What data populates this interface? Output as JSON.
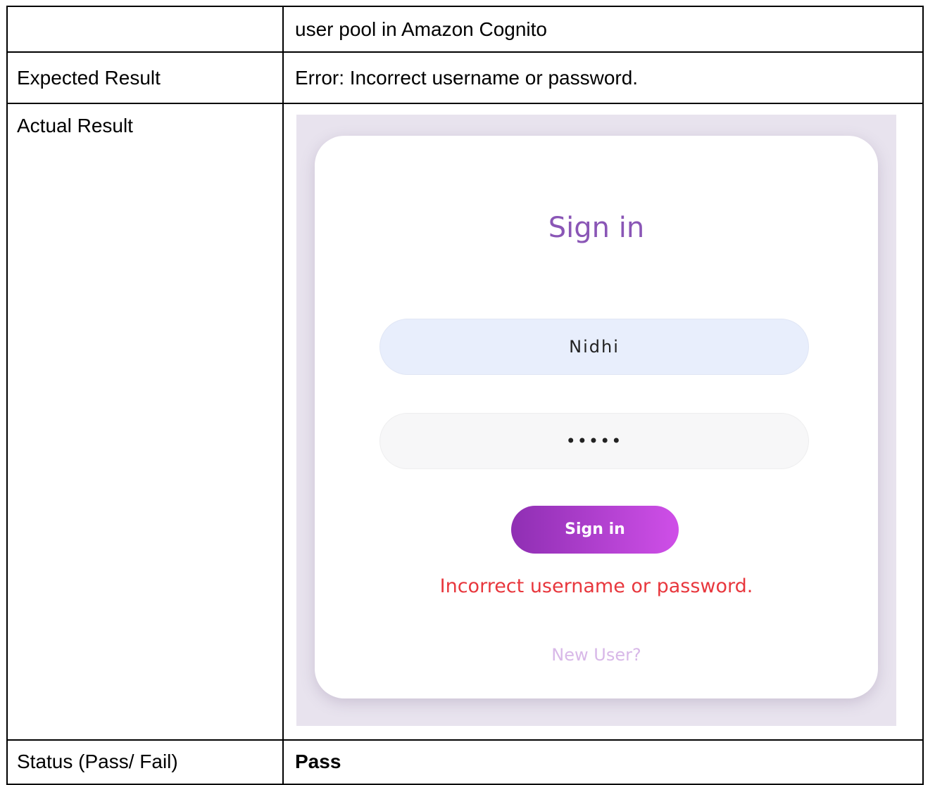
{
  "table": {
    "rows": [
      {
        "label": "",
        "value": "user pool in Amazon Cognito"
      },
      {
        "label": "Expected Result",
        "value": "Error: Incorrect username or password."
      },
      {
        "label": "Actual Result",
        "value": ""
      },
      {
        "label": "Status (Pass/ Fail)",
        "value": "Pass"
      }
    ]
  },
  "screenshot": {
    "title": "Sign in",
    "username_value": "Nidhi",
    "password_value": "•••••",
    "button_label": "Sign in",
    "error_message": "Incorrect username or password.",
    "new_user_link": "New User?",
    "colors": {
      "title": "#8a56b6",
      "button_gradient_start": "#8f2fb3",
      "button_gradient_end": "#cf4fe8",
      "error": "#e8373d",
      "link": "#d8b8e8",
      "username_field_bg": "#e8eefc"
    }
  }
}
